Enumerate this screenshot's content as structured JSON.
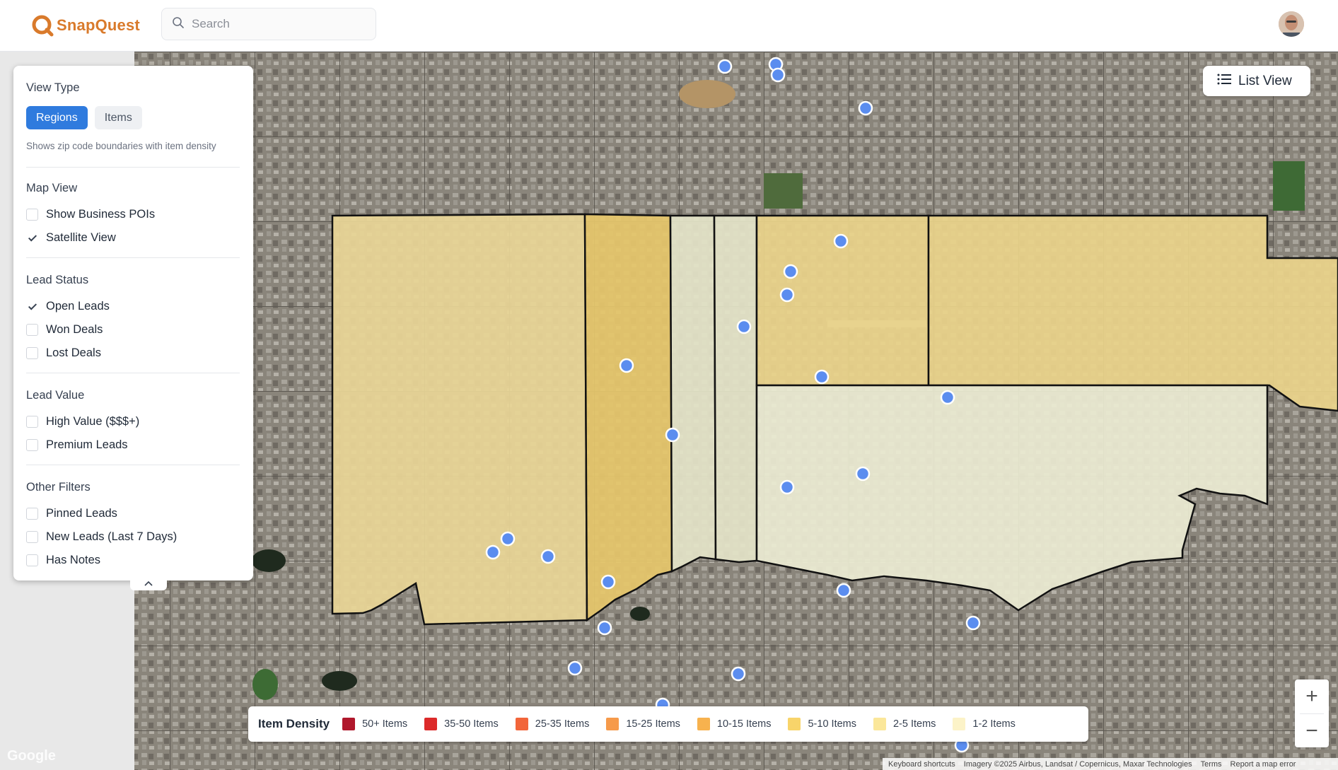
{
  "header": {
    "app_name": "SnapQuest",
    "search_placeholder": "Search",
    "brand_color": "#d97a2b"
  },
  "filters": {
    "view_type": {
      "title": "View Type",
      "options": [
        "Regions",
        "Items"
      ],
      "selected": "Regions",
      "hint": "Shows zip code boundaries with item density"
    },
    "map_view": {
      "title": "Map View",
      "items": [
        {
          "label": "Show Business POIs",
          "checked": false
        },
        {
          "label": "Satellite View",
          "checked": true
        }
      ]
    },
    "lead_status": {
      "title": "Lead Status",
      "items": [
        {
          "label": "Open Leads",
          "checked": true
        },
        {
          "label": "Won Deals",
          "checked": false
        },
        {
          "label": "Lost Deals",
          "checked": false
        }
      ]
    },
    "lead_value": {
      "title": "Lead Value",
      "items": [
        {
          "label": "High Value ($$$+)",
          "checked": false
        },
        {
          "label": "Premium Leads",
          "checked": false
        }
      ]
    },
    "other_filters": {
      "title": "Other Filters",
      "items": [
        {
          "label": "Pinned Leads",
          "checked": false
        },
        {
          "label": "New Leads (Last 7 Days)",
          "checked": false
        },
        {
          "label": "Has Notes",
          "checked": false
        }
      ]
    }
  },
  "list_view_button": {
    "label": "List View",
    "icon": "list-icon"
  },
  "legend": {
    "title": "Item Density",
    "items": [
      {
        "label": "50+ Items",
        "color": "#b0182c"
      },
      {
        "label": "35-50 Items",
        "color": "#dc2a2a"
      },
      {
        "label": "25-35 Items",
        "color": "#f2653a"
      },
      {
        "label": "15-25 Items",
        "color": "#f69a4a"
      },
      {
        "label": "10-15 Items",
        "color": "#f7b24e"
      },
      {
        "label": "5-10 Items",
        "color": "#f8d46a"
      },
      {
        "label": "2-5 Items",
        "color": "#fbe79a"
      },
      {
        "label": "1-2 Items",
        "color": "#fcf3c8"
      }
    ]
  },
  "zoom": {
    "in_label": "+",
    "out_label": "−"
  },
  "attribution": {
    "keyboard": "Keyboard shortcuts",
    "imagery": "Imagery ©2025 Airbus, Landsat / Copernicus, Maxar Technologies",
    "terms": "Terms",
    "report": "Report a map error"
  },
  "map_brand": "Google"
}
